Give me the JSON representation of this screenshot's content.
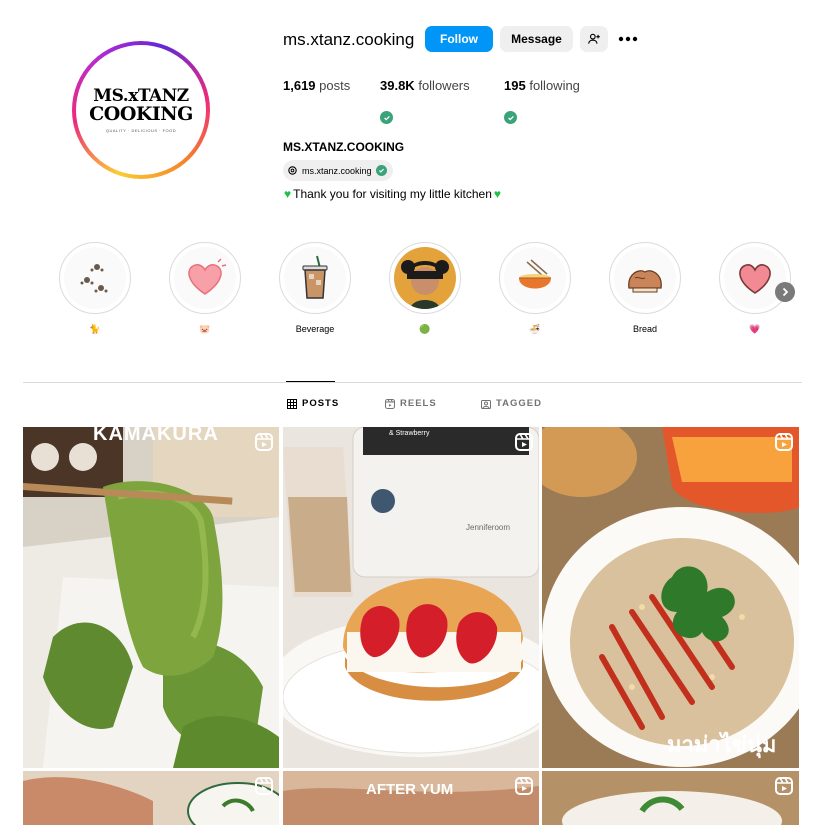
{
  "profile": {
    "username": "ms.xtanz.cooking",
    "logo_line1": "MS.xTANZ",
    "logo_line2": "COOKING",
    "logo_sub": "QUALITY · DELICIOUS · FOOD",
    "follow_label": "Follow",
    "message_label": "Message",
    "full_name": "MS.XTANZ.COOKING",
    "threads_handle": "ms.xtanz.cooking",
    "bio": "Thank you for visiting my little kitchen",
    "bio_emoji": "💚"
  },
  "stats": {
    "posts_count": "1,619",
    "posts_label": "posts",
    "followers_count": "39.8K",
    "followers_label": "followers",
    "following_count": "195",
    "following_label": "following"
  },
  "highlights": [
    {
      "label": "🐈",
      "icon": "paw-prints-icon"
    },
    {
      "label": "🐷",
      "icon": "pink-heart-icon"
    },
    {
      "label": "Beverage",
      "icon": "iced-coffee-icon"
    },
    {
      "label": "🟢",
      "icon": "person-with-bear-hat-photo"
    },
    {
      "label": "🍜",
      "icon": "noodle-bowl-icon"
    },
    {
      "label": "Bread",
      "icon": "bread-icon"
    },
    {
      "label": "💗",
      "icon": "heart-icon"
    }
  ],
  "tabs": [
    {
      "label": "POSTS",
      "icon": "grid-icon",
      "active": true
    },
    {
      "label": "REELS",
      "icon": "reels-icon",
      "active": false
    },
    {
      "label": "TAGGED",
      "icon": "tagged-icon",
      "active": false
    }
  ],
  "posts": [
    {
      "overlay_text": "KAMAKURA",
      "icon": "reel-icon"
    },
    {
      "overlay_text": "& Strawberry",
      "brand_text": "Jenniferoom",
      "icon": "reel-icon"
    },
    {
      "overlay_text": "มาม่าไข่นุ่ม",
      "icon": "reel-icon"
    },
    {
      "overlay_text": "",
      "icon": "reel-icon"
    },
    {
      "overlay_text": "AFTER YUM",
      "icon": "reel-icon"
    },
    {
      "overlay_text": "",
      "icon": "reel-icon"
    }
  ],
  "colors": {
    "follow_button": "#0095f6",
    "verified": "#3aa37a",
    "divider": "#dbdbdb"
  }
}
